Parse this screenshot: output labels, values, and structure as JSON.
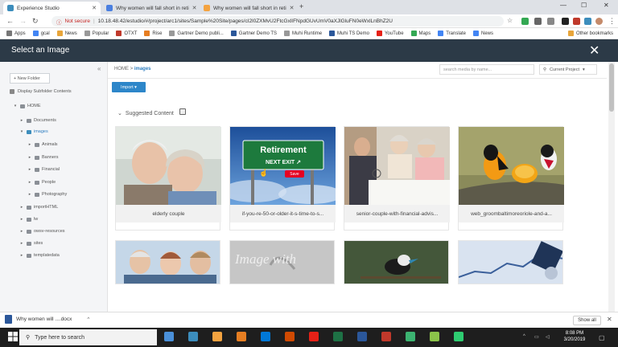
{
  "browser": {
    "tabs": [
      {
        "title": "Experience Studio",
        "color": "#3c8dbc"
      },
      {
        "title": "Why women will fall short in reti",
        "color": "#4a7fe0"
      },
      {
        "title": "Why women will fall short in reti",
        "color": "#f4a340"
      }
    ],
    "new_tab": "+",
    "window_controls": {
      "minimize": "—",
      "maximize": "☐",
      "close": "✕"
    },
    "url_prefix": "Not secure",
    "url": "10.18.48.42/estudio/#/project/arc1/sites/Sample%20Site/pages/cI2l0ZXMvU2FtcGxlIFNpdGUvUmV0aXJlGluFN0eWxlLnBhZ2U",
    "bookmarks": [
      {
        "label": "Apps",
        "color": "#777"
      },
      {
        "label": "gcal",
        "color": "#4285f4"
      },
      {
        "label": "News",
        "color": "#e8a53a"
      },
      {
        "label": "Popular",
        "color": "#999"
      },
      {
        "label": "OTXT",
        "color": "#c0392b"
      },
      {
        "label": "Rise",
        "color": "#e67e22"
      },
      {
        "label": "Gartner Demo publi...",
        "color": "#999"
      },
      {
        "label": "Gartner Demo TS",
        "color": "#2b579a"
      },
      {
        "label": "Muhi Runtime",
        "color": "#999"
      },
      {
        "label": "Muhi TS Demo",
        "color": "#2b579a"
      },
      {
        "label": "YouTube",
        "color": "#e62117"
      },
      {
        "label": "Maps",
        "color": "#34a853"
      },
      {
        "label": "Translate",
        "color": "#4285f4"
      },
      {
        "label": "News",
        "color": "#4285f4"
      },
      {
        "label": "Other bookmarks",
        "color": "#e8a53a"
      }
    ]
  },
  "modal": {
    "title": "Select an Image",
    "close": "✕"
  },
  "sidebar": {
    "new_folder": "+ New Folder",
    "collapse": "«",
    "display_subfolder": "Display Subfolder Contents",
    "tree": [
      {
        "label": "HOME",
        "caret": "▾",
        "level": 0
      },
      {
        "label": "Documents",
        "caret": "▸",
        "level": 1
      },
      {
        "label": "images",
        "caret": "▾",
        "level": 1,
        "selected": true
      },
      {
        "label": "Animals",
        "caret": "▸",
        "level": 2
      },
      {
        "label": "Banners",
        "caret": "▸",
        "level": 2
      },
      {
        "label": "Financial",
        "caret": "▸",
        "level": 2
      },
      {
        "label": "People",
        "caret": "▸",
        "level": 2
      },
      {
        "label": "Photography",
        "caret": "▸",
        "level": 2
      },
      {
        "label": "importHTML",
        "caret": "▸",
        "level": 1
      },
      {
        "label": "lw",
        "caret": "▸",
        "level": 1
      },
      {
        "label": "owsv-resources",
        "caret": "▸",
        "level": 1
      },
      {
        "label": "sites",
        "caret": "▸",
        "level": 1
      },
      {
        "label": "templatedata",
        "caret": "▸",
        "level": 1
      }
    ]
  },
  "main": {
    "breadcrumb_home": "HOME",
    "breadcrumb_sep": " > ",
    "breadcrumb_current": "images",
    "search_placeholder": "search media by name...",
    "scope": "Current Project",
    "import_label": "Import ▾",
    "suggested_label": "Suggested Content",
    "suggested_caret": "⌄",
    "cards": [
      {
        "caption": "elderly couple"
      },
      {
        "caption": "if-you-re-50-or-older-it-s-time-to-s..."
      },
      {
        "caption": "senior-couple-with-financial-advis..."
      },
      {
        "caption": "web_groombaltimoreoriole-and-a..."
      }
    ],
    "retirement_sign": {
      "line1": "Retirement",
      "line2": "NEXT EXIT ↗",
      "save": "Save"
    },
    "watermark_text": "Image with"
  },
  "downloads": {
    "file": "Why women will ....docx",
    "caret": "^",
    "show_all": "Show all",
    "close": "✕"
  },
  "taskbar": {
    "search_placeholder": "Type here to search",
    "time": "8:08 PM",
    "date": "3/20/2019",
    "icons": [
      "#4a90d9",
      "#3c8dbc",
      "#f4a340",
      "#e67e22",
      "#0078d7",
      "#d04a02",
      "#e62117",
      "#1e7145",
      "#2b579a",
      "#c0392b",
      "#3cb371",
      "#8bc34a",
      "#2ecc71"
    ]
  }
}
